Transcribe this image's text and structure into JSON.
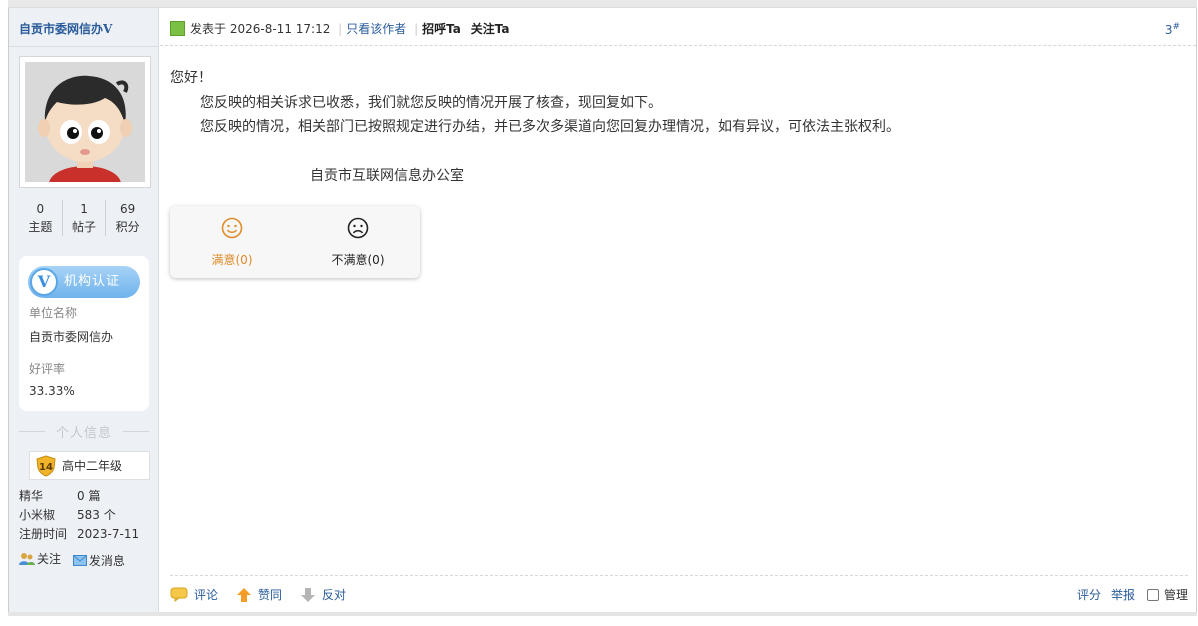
{
  "colors": {
    "link": "#2a5c9a",
    "sidebar_bg": "#edf1f6",
    "satisfied": "#e08b2a",
    "cert_gradient_start": "#a7d3f6",
    "cert_gradient_end": "#6fb3ec",
    "level_badge": "#f0b429"
  },
  "sidebar": {
    "author_name": "自贡市委网信办",
    "author_v_mark": "V",
    "stats": [
      {
        "value": "0",
        "label": "主题"
      },
      {
        "value": "1",
        "label": "帖子"
      },
      {
        "value": "69",
        "label": "积分"
      }
    ],
    "certification": {
      "badge_mark": "V",
      "badge_text": "机构认证",
      "unit_label": "单位名称",
      "unit_value": "自贡市委网信办",
      "rating_label": "好评率",
      "rating_value": "33.33%"
    },
    "personal_info_title": "个人信息",
    "level": {
      "number": "14",
      "name": "高中二年级"
    },
    "info_rows": [
      {
        "key": "精华",
        "value": "0 篇"
      },
      {
        "key": "小米椒",
        "value": "583 个"
      },
      {
        "key": "注册时间",
        "value": "2023-7-11"
      }
    ],
    "actions": {
      "follow": "关注",
      "message": "发消息"
    }
  },
  "post": {
    "posted_prefix": "发表于",
    "posted_time": "2026-8-11 17:12",
    "only_author": "只看该作者",
    "greet": "招呼Ta",
    "follow": "关注Ta",
    "floor_number": "3",
    "floor_mark": "#",
    "body": {
      "greeting": "您好！",
      "line1": "您反映的相关诉求已收悉，我们就您反映的情况开展了核查，现回复如下。",
      "line2": "您反映的情况，相关部门已按照规定进行办结，并已多次多渠道向您回复办理情况，如有异议，可依法主张权利。",
      "signature": "自贡市互联网信息办公室"
    },
    "votes": {
      "satisfied": "满意(0)",
      "unsatisfied": "不满意(0)"
    },
    "footer": {
      "comment": "评论",
      "like": "赞同",
      "oppose": "反对",
      "rate": "评分",
      "report": "举报",
      "manage": "管理"
    }
  }
}
